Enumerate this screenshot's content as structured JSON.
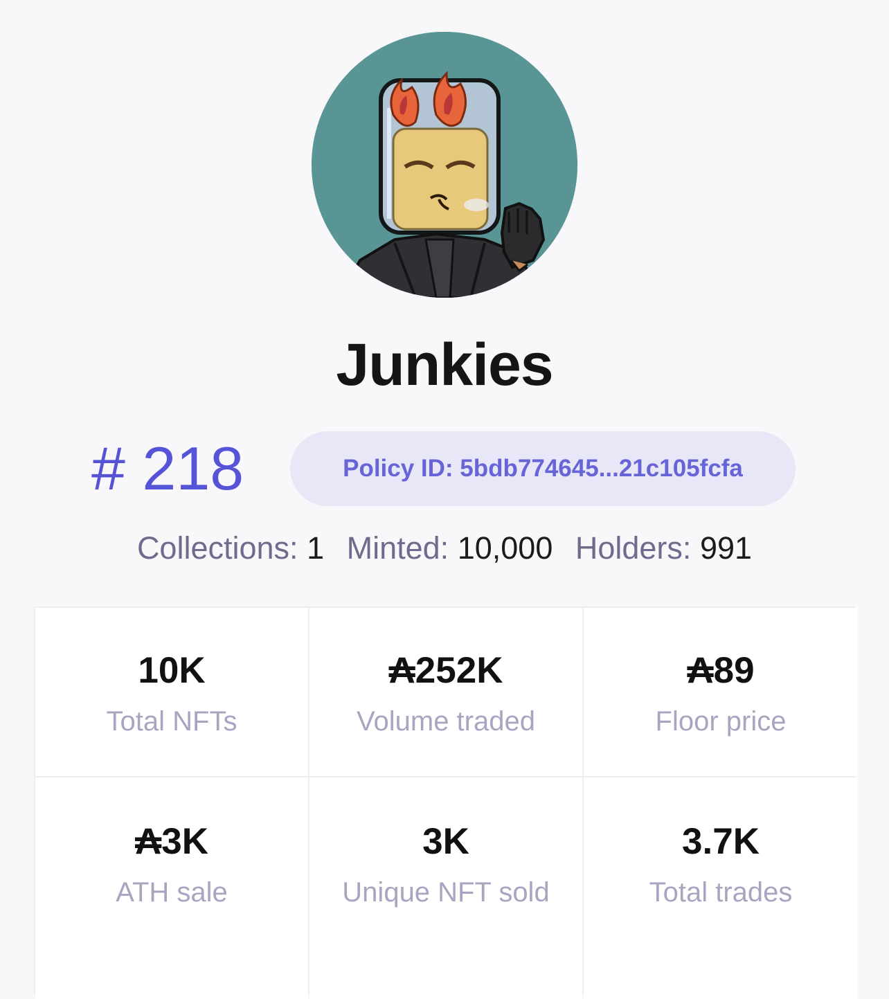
{
  "collection": {
    "name": "Junkies",
    "rank": "# 218",
    "policy_id": "Policy ID: 5bdb774645...21c105fcfa"
  },
  "summary": {
    "collections_label": "Collections:",
    "collections_value": "1",
    "minted_label": "Minted:",
    "minted_value": "10,000",
    "holders_label": "Holders:",
    "holders_value": "991"
  },
  "stats": [
    {
      "value": "10K",
      "label": "Total NFTs"
    },
    {
      "value": "₳252K",
      "label": "Volume traded"
    },
    {
      "value": "₳89",
      "label": "Floor price"
    },
    {
      "value": "₳3K",
      "label": "ATH sale"
    },
    {
      "value": "3K",
      "label": "Unique NFT sold"
    },
    {
      "value": "3.7K",
      "label": "Total trades"
    }
  ],
  "colors": {
    "accent": "#5553d6",
    "policy_bg": "#e8e7f8",
    "label": "#a7a6c0",
    "avatar_bg": "#5a9595"
  }
}
